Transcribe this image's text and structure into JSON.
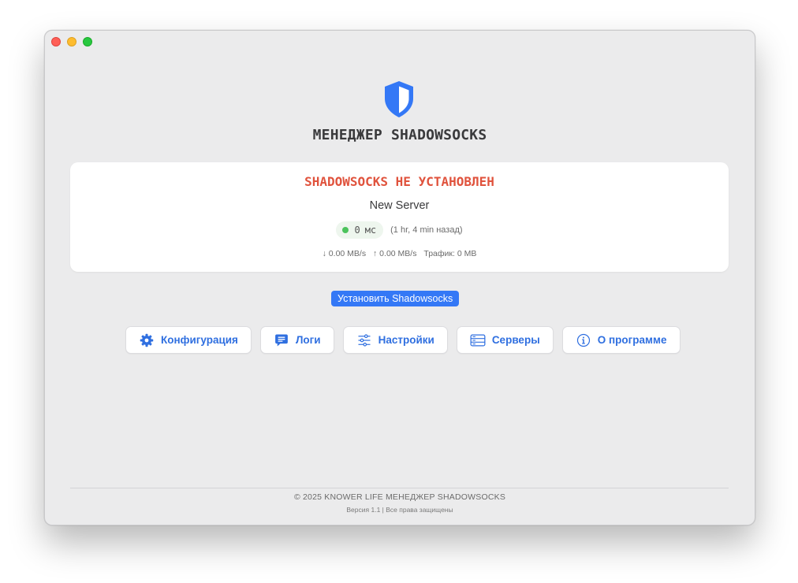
{
  "app": {
    "title": "МЕНЕДЖЕР SHADOWSOCKS",
    "logo_icon": "shield-half-icon",
    "accent_color": "#3478f6"
  },
  "status": {
    "title": "SHADOWSOCKS НЕ УСТАНОВЛЕН",
    "title_color": "#e0533d",
    "server_name": "New Server",
    "ping_value": "0",
    "ping_unit": "мс",
    "ping_status_color": "#4cc35c",
    "ping_ago": "(1 hr, 4 min назад)",
    "download": "↓ 0.00 MB/s",
    "upload": "↑ 0.00 MB/s",
    "traffic": "Трафик: 0 MB"
  },
  "install_button": {
    "label": "Установить Shadowsocks"
  },
  "nav": [
    {
      "label": "Конфигурация",
      "icon": "gear-icon"
    },
    {
      "label": "Логи",
      "icon": "chat-bubble-icon"
    },
    {
      "label": "Настройки",
      "icon": "sliders-icon"
    },
    {
      "label": "Серверы",
      "icon": "server-rack-icon"
    },
    {
      "label": "О программе",
      "icon": "info-circle-icon"
    }
  ],
  "footer": {
    "copyright": "© 2025 KNOWER LIFE МЕНЕДЖЕР SHADOWSOCKS",
    "version": "Версия 1.1 | Все права защищены"
  }
}
